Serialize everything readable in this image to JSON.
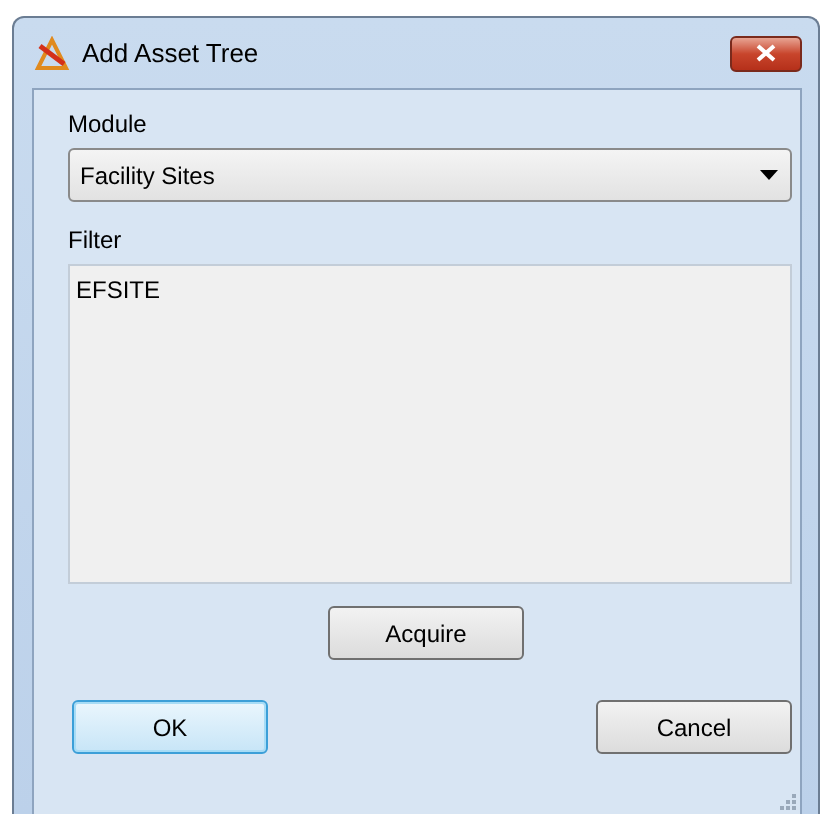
{
  "window": {
    "title": "Add Asset Tree"
  },
  "module": {
    "label": "Module",
    "value": "Facility Sites"
  },
  "filter": {
    "label": "Filter",
    "value": "EFSITE"
  },
  "acquire_button": "Acquire",
  "buttons": [
    {
      "label": "OK",
      "focused": true
    },
    {
      "label": "Cancel",
      "focused": false
    }
  ]
}
